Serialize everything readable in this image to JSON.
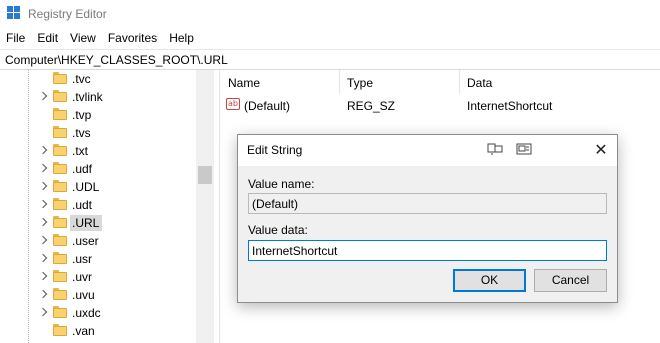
{
  "window": {
    "title": "Registry Editor"
  },
  "menu": [
    "File",
    "Edit",
    "View",
    "Favorites",
    "Help"
  ],
  "address": "Computer\\HKEY_CLASSES_ROOT\\.URL",
  "tree": {
    "items": [
      {
        "label": ".tvc",
        "expander": false,
        "selected": false
      },
      {
        "label": ".tvlink",
        "expander": true,
        "selected": false
      },
      {
        "label": ".tvp",
        "expander": false,
        "selected": false
      },
      {
        "label": ".tvs",
        "expander": false,
        "selected": false
      },
      {
        "label": ".txt",
        "expander": true,
        "selected": false
      },
      {
        "label": ".udf",
        "expander": true,
        "selected": false
      },
      {
        "label": ".UDL",
        "expander": true,
        "selected": false
      },
      {
        "label": ".udt",
        "expander": true,
        "selected": false
      },
      {
        "label": ".URL",
        "expander": true,
        "selected": true
      },
      {
        "label": ".user",
        "expander": true,
        "selected": false
      },
      {
        "label": ".usr",
        "expander": true,
        "selected": false
      },
      {
        "label": ".uvr",
        "expander": true,
        "selected": false
      },
      {
        "label": ".uvu",
        "expander": true,
        "selected": false
      },
      {
        "label": ".uxdc",
        "expander": true,
        "selected": false
      },
      {
        "label": ".van",
        "expander": false,
        "selected": false
      }
    ]
  },
  "list": {
    "columns": [
      "Name",
      "Type",
      "Data"
    ],
    "rows": [
      {
        "icon": "string-value-icon",
        "icon_text": "ab",
        "name": "(Default)",
        "type": "REG_SZ",
        "data": "InternetShortcut"
      }
    ]
  },
  "dialog": {
    "title": "Edit String",
    "value_name_label": "Value name:",
    "value_name": "(Default)",
    "value_data_label": "Value data:",
    "value_data": "InternetShortcut",
    "ok_label": "OK",
    "cancel_label": "Cancel",
    "close_glyph": "✕"
  },
  "colors": {
    "accent": "#0078d7",
    "folder": "#f7d26f",
    "selected_bg": "#d9d9d9",
    "dialog_bg": "#f0f0f0"
  }
}
